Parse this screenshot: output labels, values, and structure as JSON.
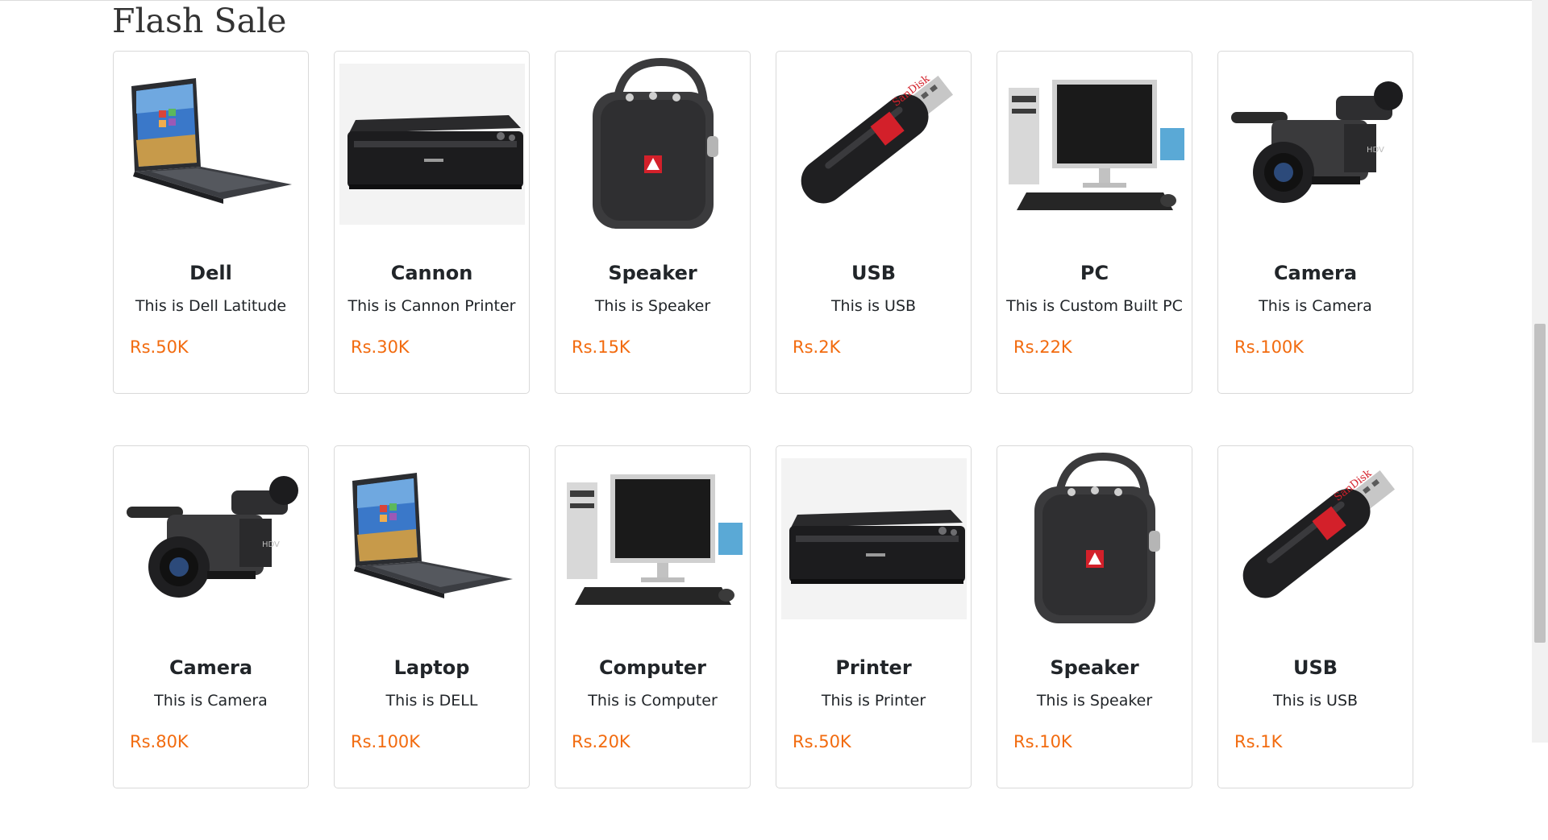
{
  "section": {
    "title": "Flash Sale"
  },
  "products": [
    {
      "name": "Dell",
      "desc": "This is Dell Latitude",
      "price": "Rs.50K",
      "icon": "laptop"
    },
    {
      "name": "Cannon",
      "desc": "This is Cannon Printer",
      "price": "Rs.30K",
      "icon": "printer"
    },
    {
      "name": "Speaker",
      "desc": "This is Speaker",
      "price": "Rs.15K",
      "icon": "speaker"
    },
    {
      "name": "USB",
      "desc": "This is USB",
      "price": "Rs.2K",
      "icon": "usb"
    },
    {
      "name": "PC",
      "desc": "This is Custom Built PC",
      "price": "Rs.22K",
      "icon": "pc"
    },
    {
      "name": "Camera",
      "desc": "This is Camera",
      "price": "Rs.100K",
      "icon": "camera"
    },
    {
      "name": "Camera",
      "desc": "This is Camera",
      "price": "Rs.80K",
      "icon": "camera"
    },
    {
      "name": "Laptop",
      "desc": "This is DELL",
      "price": "Rs.100K",
      "icon": "laptop"
    },
    {
      "name": "Computer",
      "desc": "This is Computer",
      "price": "Rs.20K",
      "icon": "pc"
    },
    {
      "name": "Printer",
      "desc": "This is Printer",
      "price": "Rs.50K",
      "icon": "printer"
    },
    {
      "name": "Speaker",
      "desc": "This is Speaker",
      "price": "Rs.10K",
      "icon": "speaker"
    },
    {
      "name": "USB",
      "desc": "This is USB",
      "price": "Rs.1K",
      "icon": "usb"
    }
  ],
  "colors": {
    "price": "#f26b0f",
    "border": "#d9d9d9"
  }
}
